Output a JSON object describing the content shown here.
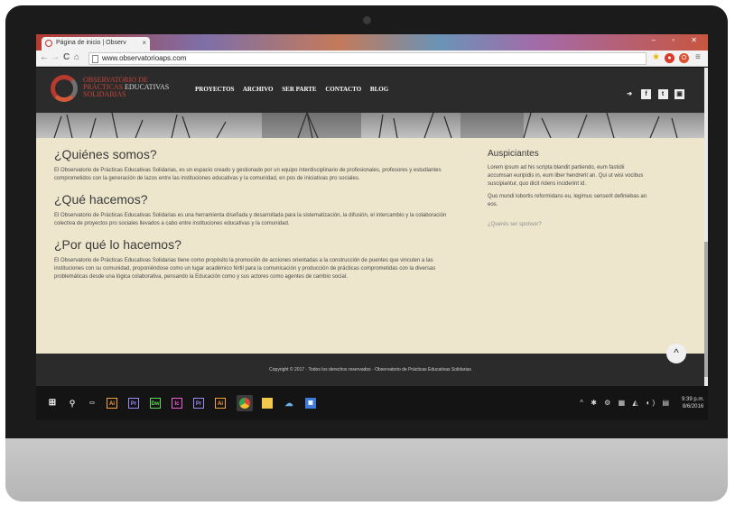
{
  "browser": {
    "tab_title": "Página de inicio | Observ",
    "tab_close": "×",
    "url": "www.observatorioaps.com",
    "back": "←",
    "forward": "→",
    "reload": "C",
    "home": "⌂",
    "star": "★",
    "menu": "≡"
  },
  "site": {
    "logo": {
      "line1": "OBSERVATORIO DE",
      "line2a": "PRÁCTICAS",
      "line2b": "EDUCATIVAS",
      "line3": "SOLIDARIAS"
    },
    "nav": [
      "PROYECTOS",
      "ARCHIVO",
      "SER PARTE",
      "CONTACTO",
      "BLOG"
    ],
    "social": [
      "➔",
      "f",
      "t",
      "▣"
    ]
  },
  "main": {
    "h1": "¿Quiénes somos?",
    "p1": "El Observatorio de Prácticas Educativas Solidarias, es un espacio creado y gestionado por un equipo interdisciplinario de profesionales, profesores y estudiantes comprometidos con la generación de lazos entre las instituciones educativas y la comunidad, en pos de iniciativas pro sociales.",
    "h2": "¿Qué hacemos?",
    "p2": "El Observatorio de Prácticas Educativas Solidarias es una herramienta diseñada y desarrollada para la sistematización, la difusión, el intercambio y la colaboración colectiva de proyectos pro sociales llevados a cabo entre instituciones educativas y la comunidad.",
    "h3": "¿Por qué lo hacemos?",
    "p3": "El Observatorio de Prácticas Educativas Solidarias tiene como propósito la promoción de acciones orientadas a la construcción de puentes que vinculen a las instituciones con su comunidad, proponiéndose como un lugar académico fértil para la comunicación y producción de prácticas comprometidas con la diversas problemáticas desde una lógica colaborativa, pensando la Educación como y sus actores como agentes de cambio social."
  },
  "sidebar": {
    "title": "Auspiciantes",
    "p1": "Lorem ipsum ad his scripta blandit partiendo, eum fastidii accumsan euripidis in, eum liber hendrerit an. Qui ut wisi vocibus suscipiantur, quo dicit ridens inciderint id.",
    "p2": "Quo mundi lobortis reformidans eu, legimus senserit definiebas an eos.",
    "link": "¿Querés ser sponsor?"
  },
  "footer": {
    "copyright": "Copyright © 2017 · Todos los derechos reservados · Observatorio de Prácticas Educativas Solidarias",
    "to_top": "^"
  },
  "taskbar": {
    "apps": [
      {
        "label": "Ai",
        "color": "#f7a23b"
      },
      {
        "label": "Pr",
        "color": "#9b8cf5"
      },
      {
        "label": "Dw",
        "color": "#65d45c"
      },
      {
        "label": "Ic",
        "color": "#f35bd8"
      },
      {
        "label": "Pr",
        "color": "#9b8cf5"
      },
      {
        "label": "Ai",
        "color": "#f7a23b"
      }
    ],
    "tray": "^ ✱ ⚙ ▦ ◭ ◖) ▤",
    "time": "9:39 p.m.",
    "date": "8/6/2016"
  }
}
